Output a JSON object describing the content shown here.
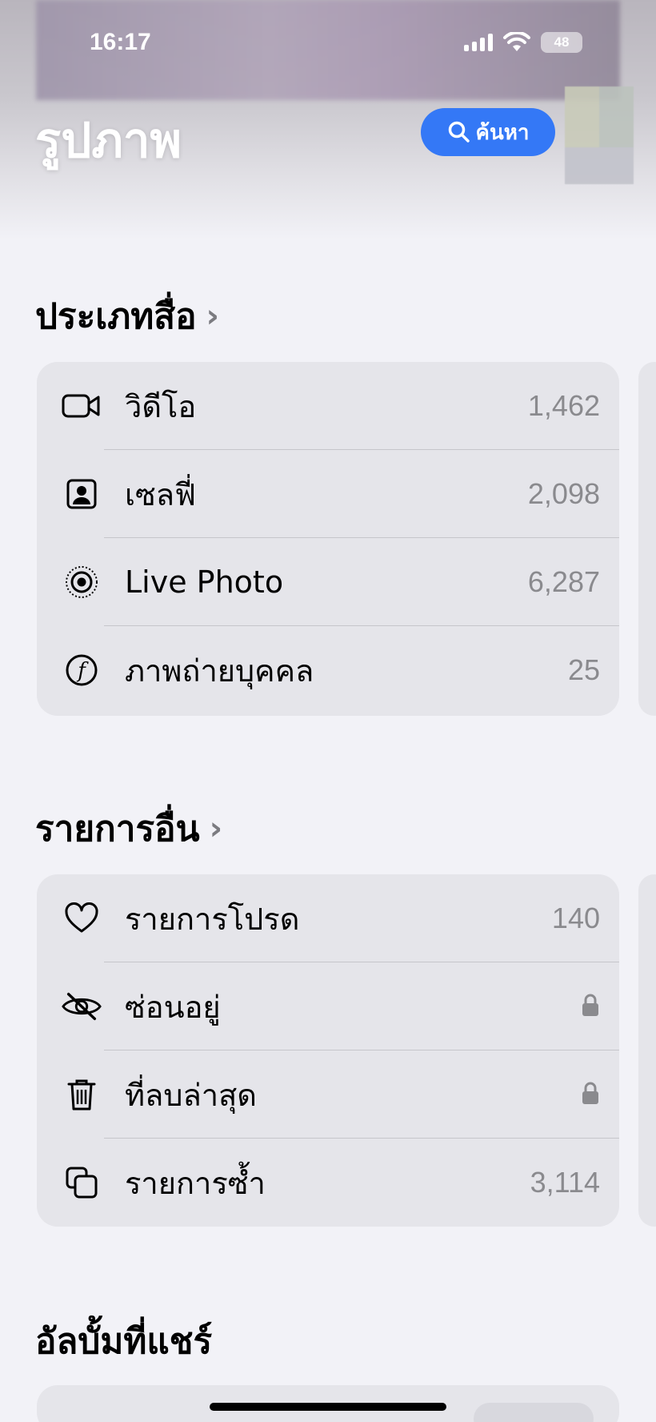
{
  "status_bar": {
    "time": "16:17",
    "battery": "48"
  },
  "header": {
    "title": "รูปภาพ",
    "search_label": "ค้นหา"
  },
  "media_types": {
    "title": "ประเภทสื่อ",
    "items": [
      {
        "label": "วิดีโอ",
        "count": "1,462",
        "icon": "video-icon"
      },
      {
        "label": "เซลฟี่",
        "count": "2,098",
        "icon": "selfie-icon"
      },
      {
        "label": "Live Photo",
        "count": "6,287",
        "icon": "live-photo-icon"
      },
      {
        "label": "ภาพถ่ายบุคคล",
        "count": "25",
        "icon": "portrait-icon"
      }
    ]
  },
  "utilities": {
    "title": "รายการอื่น",
    "items": [
      {
        "label": "รายการโปรด",
        "count": "140",
        "icon": "heart-icon"
      },
      {
        "label": "ซ่อนอยู่",
        "locked": true,
        "icon": "eye-slash-icon"
      },
      {
        "label": "ที่ลบล่าสุด",
        "locked": true,
        "icon": "trash-icon"
      },
      {
        "label": "รายการซ้ำ",
        "count": "3,114",
        "icon": "duplicate-icon"
      }
    ]
  },
  "shared_albums": {
    "title": "อัลบั้มที่แชร์"
  },
  "colors": {
    "accent": "#3478f6",
    "background": "#f2f2f7",
    "card": "#e5e5ea",
    "secondary_text": "#8a8a8e"
  }
}
